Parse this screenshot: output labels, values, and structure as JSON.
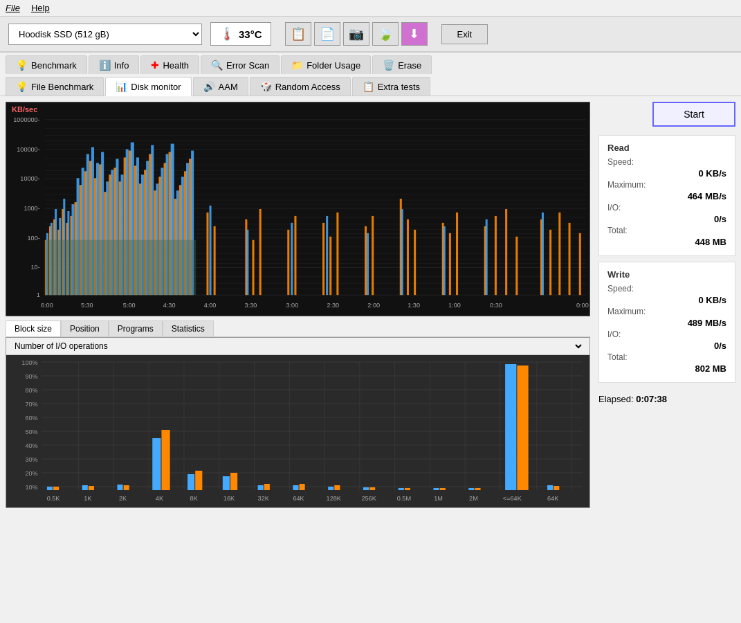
{
  "menubar": {
    "file": "File",
    "help": "Help"
  },
  "toolbar": {
    "disk_name": "Hoodisk SSD (512 gB)",
    "temperature": "33°C",
    "exit_label": "Exit"
  },
  "tabs_row1": [
    {
      "id": "benchmark",
      "label": "Benchmark",
      "icon": "💡"
    },
    {
      "id": "info",
      "label": "Info",
      "icon": "ℹ️"
    },
    {
      "id": "health",
      "label": "Health",
      "icon": "➕"
    },
    {
      "id": "errorscan",
      "label": "Error Scan",
      "icon": "🔍"
    },
    {
      "id": "folderusage",
      "label": "Folder Usage",
      "icon": "📁"
    },
    {
      "id": "erase",
      "label": "Erase",
      "icon": "🗑️"
    }
  ],
  "tabs_row2": [
    {
      "id": "filebenchmark",
      "label": "File Benchmark",
      "icon": "💡"
    },
    {
      "id": "diskmonitor",
      "label": "Disk monitor",
      "icon": "📊",
      "active": true
    },
    {
      "id": "aam",
      "label": "AAM",
      "icon": "🔊"
    },
    {
      "id": "randomaccess",
      "label": "Random Access",
      "icon": "🎲"
    },
    {
      "id": "extratests",
      "label": "Extra tests",
      "icon": "📋"
    }
  ],
  "chart": {
    "y_label": "KB/sec",
    "y_axis": [
      "1000000-",
      "100000-",
      "10000-",
      "1000-",
      "100-",
      "10-",
      "1"
    ],
    "x_axis": [
      "6:00",
      "5:30",
      "5:00",
      "4:30",
      "4:00",
      "3:30",
      "3:00",
      "2:30",
      "2:00",
      "1:30",
      "1:00",
      "0:30",
      "0:00"
    ]
  },
  "bottom_tabs": [
    {
      "id": "blocksize",
      "label": "Block size",
      "active": true
    },
    {
      "id": "position",
      "label": "Position"
    },
    {
      "id": "programs",
      "label": "Programs"
    },
    {
      "id": "statistics",
      "label": "Statistics"
    }
  ],
  "bottom_chart": {
    "dropdown_label": "Number of I/O operations",
    "y_axis": [
      "100%",
      "90%",
      "80%",
      "70%",
      "60%",
      "50%",
      "40%",
      "30%",
      "20%",
      "10%"
    ],
    "x_axis": [
      "0.5K",
      "1K",
      "2K",
      "4K",
      "8K",
      "16K",
      "32K",
      "64K",
      "128K",
      "256K",
      "0.5M",
      "1M",
      "2M",
      "<=64K",
      "64K"
    ]
  },
  "right_panel": {
    "start_label": "Start",
    "read": {
      "title": "Read",
      "speed_label": "Speed:",
      "speed_value": "0 KB/s",
      "maximum_label": "Maximum:",
      "maximum_value": "464 MB/s",
      "io_label": "I/O:",
      "io_value": "0/s",
      "total_label": "Total:",
      "total_value": "448 MB"
    },
    "write": {
      "title": "Write",
      "speed_label": "Speed:",
      "speed_value": "0 KB/s",
      "maximum_label": "Maximum:",
      "maximum_value": "489 MB/s",
      "io_label": "I/O:",
      "io_value": "0/s",
      "total_label": "Total:",
      "total_value": "802 MB"
    },
    "elapsed_label": "Elapsed:",
    "elapsed_value": "0:07:38"
  },
  "colors": {
    "accent_blue": "#4499ff",
    "accent_orange": "#ff8800",
    "accent_teal": "#558866",
    "tab_active_border": "#6666ff"
  }
}
